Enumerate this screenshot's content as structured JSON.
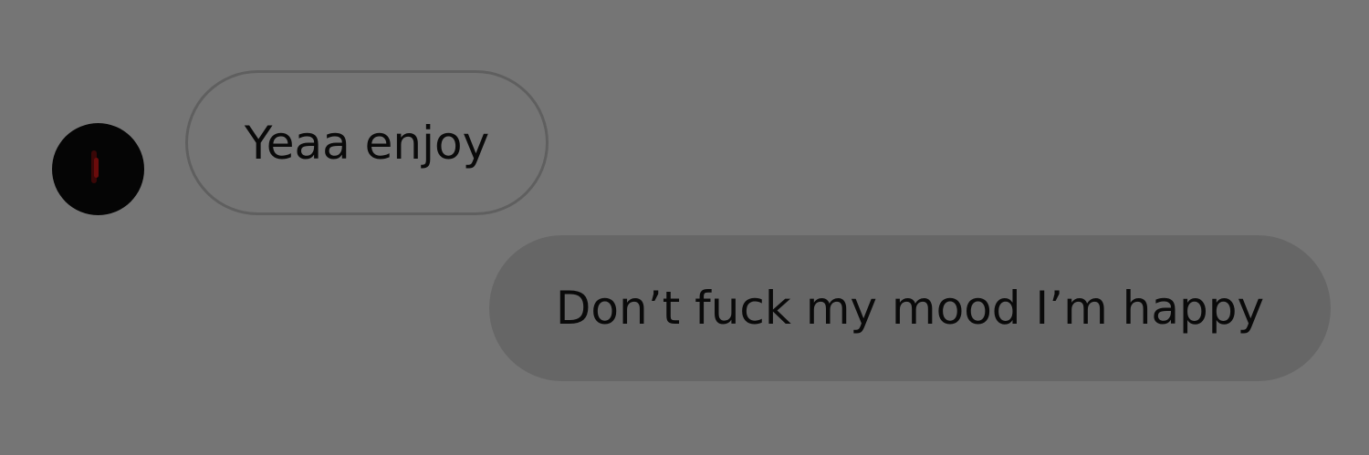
{
  "colors": {
    "background": "#757575",
    "incoming_border": "#5f5f5f",
    "outgoing_fill": "#666666",
    "text": "#0a0a0a",
    "avatar": "#050505"
  },
  "messages": [
    {
      "direction": "incoming",
      "text": "Yeaa enjoy"
    },
    {
      "direction": "outgoing",
      "text": "Don’t fuck my mood I’m happy"
    }
  ]
}
